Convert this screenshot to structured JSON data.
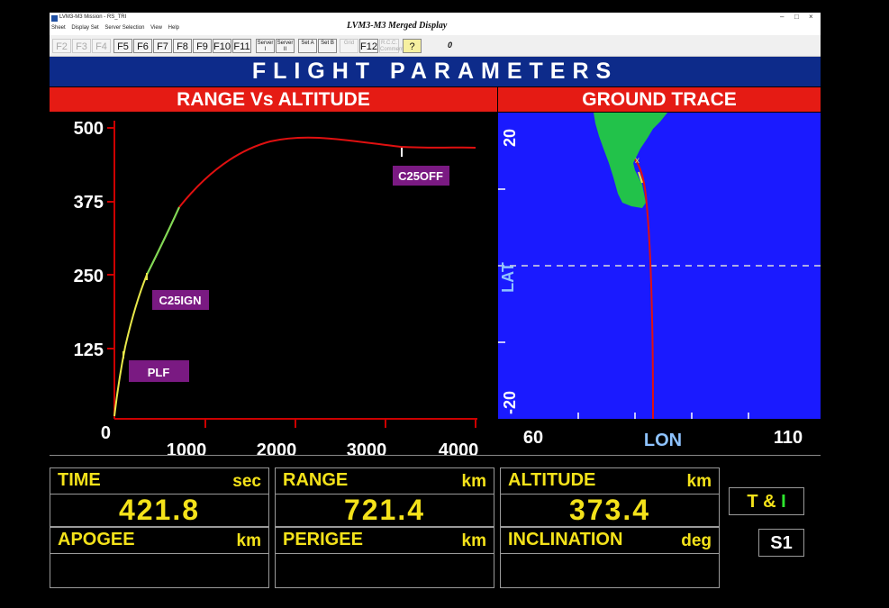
{
  "window": {
    "title": "LVM3-M3 Mission - RS_TRI",
    "controls": [
      "–",
      "□",
      "×"
    ],
    "menu": [
      "Sheet",
      "Display Set",
      "Server Selection",
      "View",
      "Help"
    ],
    "display_title": "LVM3-M3  Merged  Display"
  },
  "toolbar": {
    "keys": [
      {
        "label": "F2",
        "enabled": false
      },
      {
        "label": "F3",
        "enabled": false
      },
      {
        "label": "F4",
        "enabled": false
      },
      {
        "label": "F5",
        "enabled": true
      },
      {
        "label": "F6",
        "enabled": true
      },
      {
        "label": "F7",
        "enabled": true
      },
      {
        "label": "F8",
        "enabled": true
      },
      {
        "label": "F9",
        "enabled": true
      },
      {
        "label": "F10",
        "enabled": true
      },
      {
        "label": "F11",
        "enabled": true
      }
    ],
    "server1": "Server I",
    "server2": "Server II",
    "seta": "Set A",
    "setb": "Set B",
    "grid": "Grid",
    "f12": "F12",
    "rcc": "R.C.C. Comments",
    "help_icon": "?",
    "value": "0"
  },
  "main_title": "FLIGHT PARAMETERS",
  "range_vs_altitude": {
    "header": "RANGE   Vs   ALTITUDE",
    "y_ticks": [
      "500",
      "375",
      "250",
      "125",
      "0"
    ],
    "x_ticks": [
      "1000",
      "2000",
      "3000",
      "4000"
    ],
    "events": {
      "plf": "PLF",
      "c25ign": "C25IGN",
      "c25off": "C25OFF"
    },
    "colors": {
      "axis": "#cc0000",
      "phase1": "#e8e84a",
      "phase2": "#7ed957",
      "phase3": "#e01010",
      "event_bg": "#7a1a82"
    }
  },
  "ground_trace": {
    "header": "GROUND   TRACE",
    "lat_label": "LAT",
    "lon_label": "LON",
    "lat_ticks": [
      "20",
      "-20"
    ],
    "lon_ticks": [
      "60",
      "110"
    ],
    "colors": {
      "background": "#1a1aff",
      "land": "#22c24a",
      "track": "#e01010"
    }
  },
  "readouts": {
    "time": {
      "label": "TIME",
      "unit": "sec",
      "value": "421.8"
    },
    "range": {
      "label": "RANGE",
      "unit": "km",
      "value": "721.4"
    },
    "altitude": {
      "label": "ALTITUDE",
      "unit": "km",
      "value": "373.4"
    },
    "apogee": {
      "label": "APOGEE",
      "unit": "km",
      "value": ""
    },
    "perigee": {
      "label": "PERIGEE",
      "unit": "km",
      "value": ""
    },
    "inclination": {
      "label": "INCLINATION",
      "unit": "deg",
      "value": ""
    }
  },
  "status": {
    "tl_t": "T",
    "tl_amp": "&",
    "tl_i": "I",
    "s1": "S1"
  }
}
